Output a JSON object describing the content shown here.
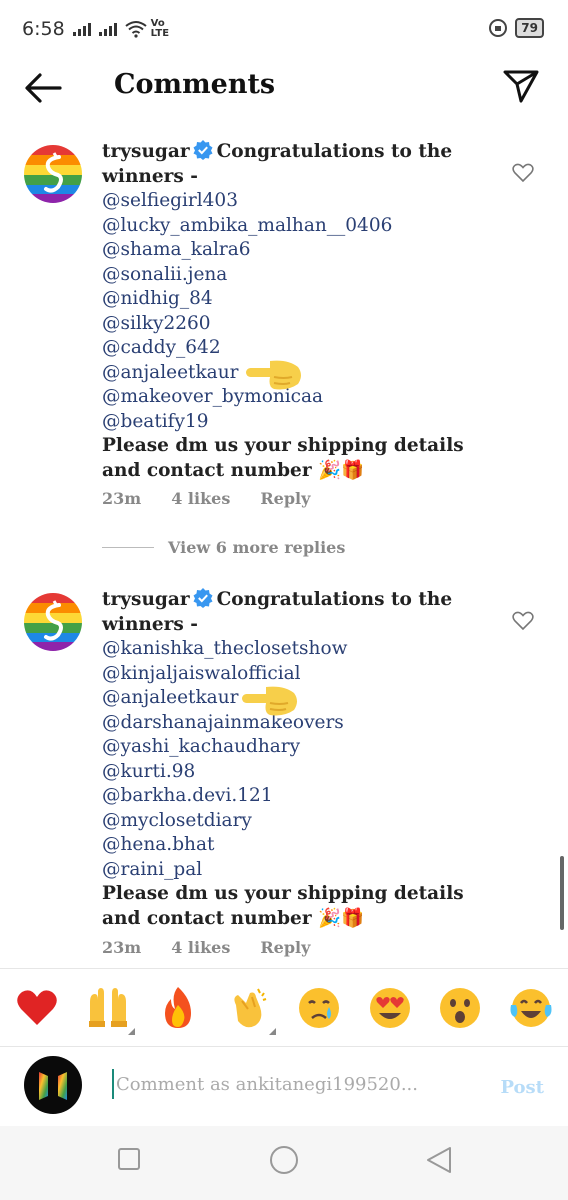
{
  "status_bar": {
    "time": "6:58",
    "network": "Vo LTE",
    "battery": "79"
  },
  "header": {
    "title": "Comments"
  },
  "comments": [
    {
      "username": "trysugar",
      "text": "Congratulations to the winners -",
      "mentions": [
        "@selfiegirl403",
        "@lucky_ambika_malhan__0406",
        "@shama_kalra6",
        "@sonalii.jena",
        "@nidhig_84",
        "@silky2260",
        "@caddy_642",
        "@anjaleetkaur",
        "@makeover_bymonicaa",
        "@beatify19"
      ],
      "closing": "Please dm us your shipping details and contact number 🎉🎁",
      "time": "23m",
      "likes": "4 likes",
      "reply": "Reply"
    },
    {
      "username": "trysugar",
      "text": "Congratulations to the winners -",
      "mentions": [
        "@kanishka_theclosetshow",
        "@kinjaljaiswalofficial",
        "@anjaleetkaur",
        "@darshanajainmakeovers",
        "@yashi_kachaudhary",
        "@kurti.98",
        "@barkha.devi.121",
        "@myclosetdiary",
        "@hena.bhat",
        "@raini_pal"
      ],
      "closing": "Please dm us your shipping details and contact number 🎉🎁",
      "time": "23m",
      "likes": "4 likes",
      "reply": "Reply"
    }
  ],
  "view_more": "View 6 more replies",
  "emoji_bar": [
    "red-heart",
    "raising-hands",
    "fire",
    "clapping-hands",
    "crying-face",
    "heart-eyes",
    "astonished-face",
    "tears-of-joy"
  ],
  "comment_input": {
    "placeholder": "Comment as ankitanegi199520...",
    "post_label": "Post"
  },
  "colors": {
    "mention": "#2a3f73",
    "verified": "#3897f0",
    "post_disabled": "#b7dcf8",
    "pointer_hand": "#f7cf4a"
  }
}
